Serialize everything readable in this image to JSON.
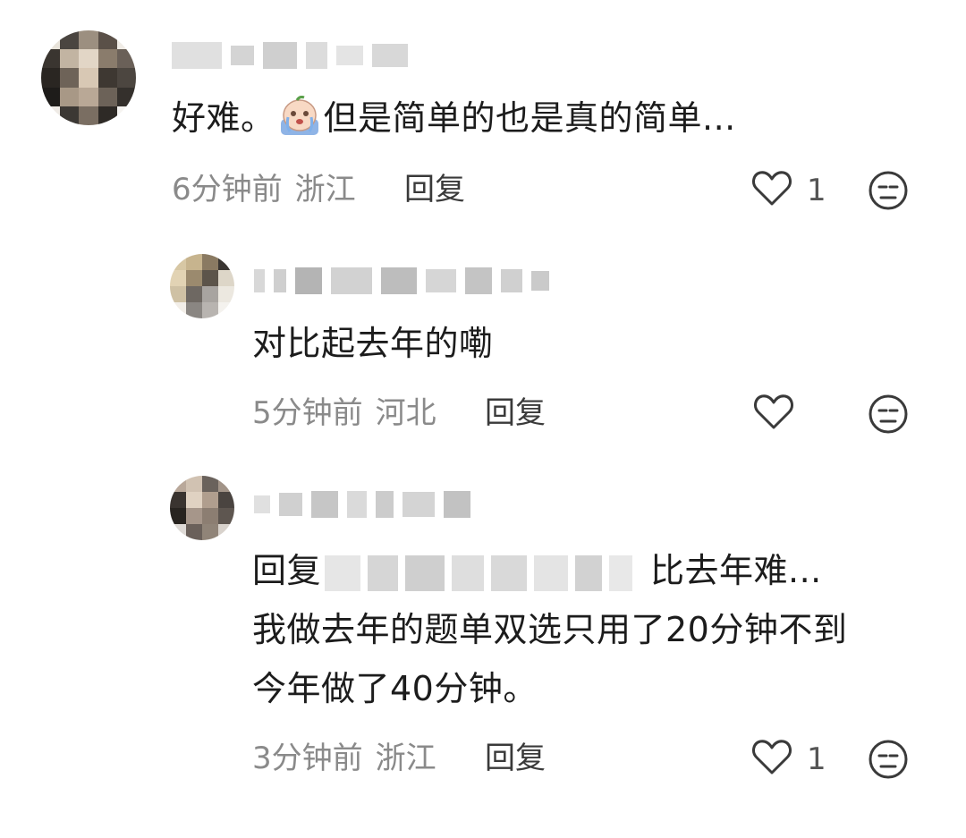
{
  "comments": [
    {
      "text_before_emoji": "好难。",
      "text_after_emoji": "但是简单的也是真的简单...",
      "time": "6分钟前",
      "location": "浙江",
      "reply_label": "回复",
      "like_count": "1"
    },
    {
      "text": "对比起去年的嘞",
      "time": "5分钟前",
      "location": "河北",
      "reply_label": "回复",
      "like_count": ""
    },
    {
      "reply_prefix": "回复",
      "reply_tail": "比去年难...",
      "line2": "我做去年的题单双选只用了20分钟不到",
      "line3": "今年做了40分钟。",
      "time": "3分钟前",
      "location": "浙江",
      "reply_label": "回复",
      "like_count": "1"
    }
  ],
  "icons": {
    "like": "heart-outline-icon",
    "dislike": "meh-face-icon",
    "emoji": "crying-face-emoji"
  },
  "colors": {
    "meta_text": "#8a8a8a",
    "icon_stroke": "#3a3a3a"
  }
}
